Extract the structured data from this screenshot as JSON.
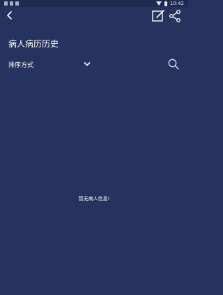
{
  "status_bar": {
    "time": "10:42"
  },
  "header": {
    "title": "病人病历历史"
  },
  "sort": {
    "label": "排序方式"
  },
  "empty_state": {
    "message": "暂无病人信息!"
  },
  "icons": {
    "back": "chevron-left-icon",
    "edit": "edit-icon",
    "share": "share-icon",
    "dropdown": "chevron-down-icon",
    "search": "search-icon"
  },
  "colors": {
    "background": "#26335f",
    "status_bar": "#1e2a50",
    "text": "#ffffff"
  }
}
